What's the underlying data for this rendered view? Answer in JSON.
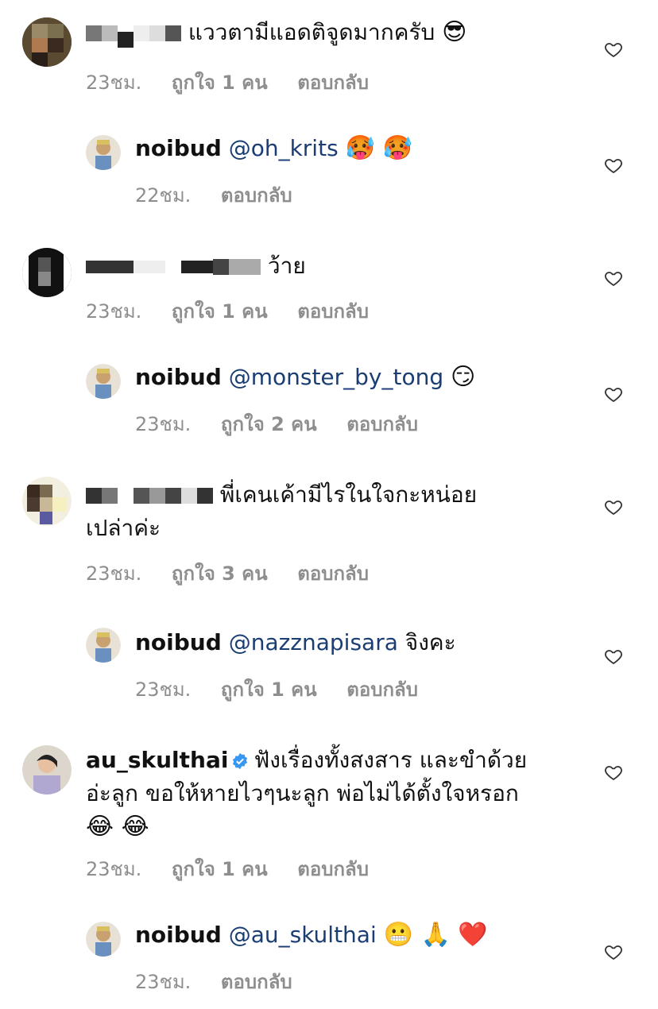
{
  "comments": [
    {
      "id": "c1",
      "type": "comment",
      "username_masked": true,
      "text": "แววตามีแอดติจูดมากครับ",
      "emoji": "😎",
      "time": "23ชม.",
      "likes": "ถูกใจ 1 คน",
      "reply": "ตอบกลับ"
    },
    {
      "id": "r1",
      "type": "reply",
      "username": "noibud",
      "mention": "@oh_krits",
      "text": "",
      "emoji": "🥵 🥵",
      "time": "22ชม.",
      "likes": "",
      "reply": "ตอบกลับ"
    },
    {
      "id": "c2",
      "type": "comment",
      "username_masked": true,
      "text": "ว้าย",
      "emoji": "",
      "time": "23ชม.",
      "likes": "ถูกใจ 1 คน",
      "reply": "ตอบกลับ"
    },
    {
      "id": "r2",
      "type": "reply",
      "username": "noibud",
      "mention": "@monster_by_tong",
      "text": "",
      "emoji": "😏",
      "time": "23ชม.",
      "likes": "ถูกใจ 2 คน",
      "reply": "ตอบกลับ"
    },
    {
      "id": "c3",
      "type": "comment",
      "username_masked": true,
      "text": "พี่เคนเค้ามีไรในใจกะหน่อย",
      "text2": "เปล่าค่ะ",
      "emoji": "",
      "time": "23ชม.",
      "likes": "ถูกใจ 3 คน",
      "reply": "ตอบกลับ"
    },
    {
      "id": "r3",
      "type": "reply",
      "username": "noibud",
      "mention": "@nazznapisara",
      "text": "จิงคะ",
      "emoji": "",
      "time": "23ชม.",
      "likes": "ถูกใจ 1 คน",
      "reply": "ตอบกลับ"
    },
    {
      "id": "c4",
      "type": "comment",
      "username": "au_skulthai",
      "verified": true,
      "text": "ฟังเรื่องทั้งสงสาร และขำด้วย",
      "text2": "อ่ะลูก ขอให้หายไวๆนะลูก พ่อไม่ได้ตั้งใจหรอก",
      "emoji": "😂 😂",
      "time": "23ชม.",
      "likes": "ถูกใจ 1 คน",
      "reply": "ตอบกลับ"
    },
    {
      "id": "r4",
      "type": "reply",
      "username": "noibud",
      "mention": "@au_skulthai",
      "text": "",
      "emoji": "😬 🙏 ❤️",
      "time": "23ชม.",
      "likes": "",
      "reply": "ตอบกลับ"
    }
  ],
  "icons": {
    "like": "heart-outline-icon",
    "verified": "verified-badge-icon"
  },
  "colors": {
    "mention": "#1a3d73",
    "meta": "#8e8e8e",
    "verified": "#3897f0"
  }
}
